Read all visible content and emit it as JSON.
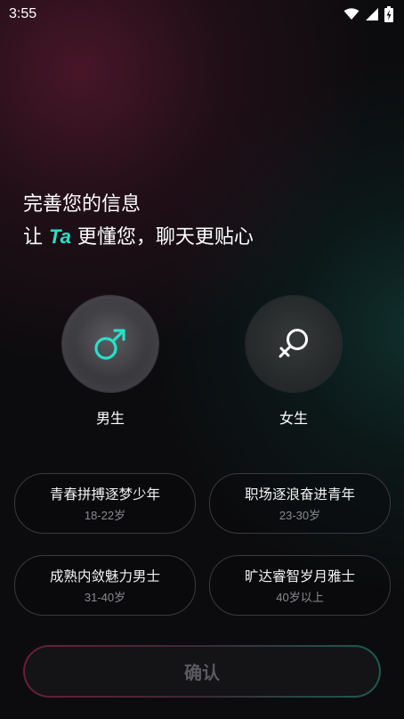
{
  "status": {
    "time": "3:55"
  },
  "headline": {
    "line1": "完善您的信息",
    "line2_prefix": "让 ",
    "line2_highlight": "Ta",
    "line2_suffix": " 更懂您，聊天更贴心",
    "highlight_color": "#27e0c8"
  },
  "gender": {
    "male_label": "男生",
    "female_label": "女生",
    "selected": "male"
  },
  "age_groups": [
    {
      "title": "青春拼搏逐梦少年",
      "range": "18-22岁"
    },
    {
      "title": "职场逐浪奋进青年",
      "range": "23-30岁"
    },
    {
      "title": "成熟内敛魅力男士",
      "range": "31-40岁"
    },
    {
      "title": "旷达睿智岁月雅士",
      "range": "40岁以上"
    }
  ],
  "confirm_label": "确认",
  "icons": [
    "wifi-icon",
    "signal-icon",
    "battery-charging-icon",
    "male-symbol-icon",
    "female-symbol-icon"
  ]
}
